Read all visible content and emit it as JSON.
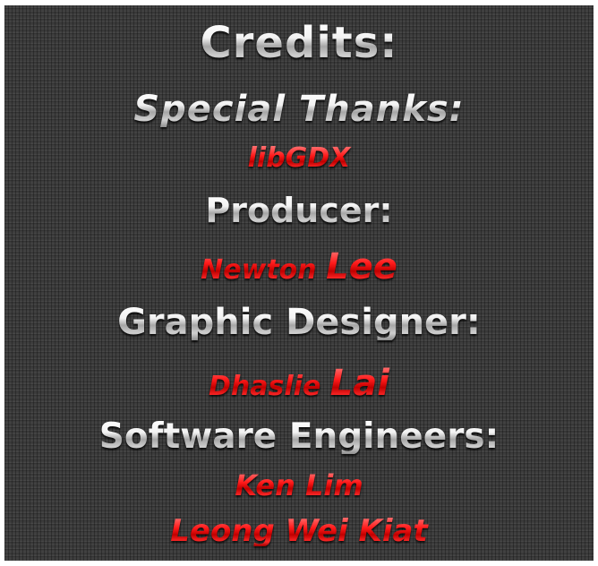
{
  "credits": {
    "title": "Credits:",
    "special_thanks_heading": "Special Thanks:",
    "special_thanks_name": "libGDX",
    "producer_heading": "Producer:",
    "producer_first": "Newton",
    "producer_last": "Lee",
    "graphic_designer_heading": "Graphic Designer:",
    "graphic_designer_first": "Dhaslie",
    "graphic_designer_last": "Lai",
    "software_engineers_heading": "Software Engineers:",
    "software_engineers": [
      "Ken Lim",
      "Leong Wei Kiat"
    ]
  },
  "colors": {
    "background": "#3d3d3d",
    "heading_text": "#d9d9d9",
    "name_text": "#e01010"
  }
}
